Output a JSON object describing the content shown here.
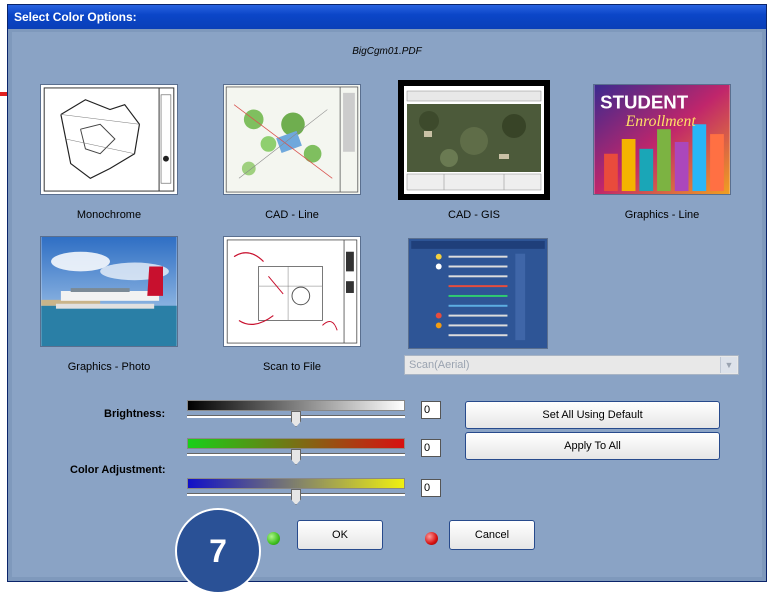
{
  "window": {
    "title": "Select Color Options:",
    "filename": "BigCgm01.PDF"
  },
  "thumbnails": [
    {
      "label": "Monochrome",
      "selected": false
    },
    {
      "label": "CAD - Line",
      "selected": false
    },
    {
      "label": "CAD - GIS",
      "selected": true
    },
    {
      "label": "Graphics - Line",
      "selected": false
    },
    {
      "label": "Graphics - Photo",
      "selected": false
    },
    {
      "label": "Scan to File",
      "selected": false
    },
    {
      "label": "",
      "selected": false
    }
  ],
  "poster_text": {
    "line1": "STUDENT",
    "line2": "Enrollment"
  },
  "combo": {
    "value": "Scan(Aerial)"
  },
  "controls": {
    "brightness_label": "Brightness:",
    "color_adjustment_label": "Color Adjustment:",
    "brightness_value": "0",
    "color_value_1": "0",
    "color_value_2": "0",
    "brightness_level": 0.5,
    "color_level_1": 0.5,
    "color_level_2": 0.5
  },
  "buttons": {
    "set_all_default": "Set All Using Default",
    "apply_to_all": "Apply To All",
    "ok": "OK",
    "cancel": "Cancel"
  },
  "step_badge": "7",
  "colors": {
    "ok_dot": "#3fbf1f",
    "cancel_dot": "#d61010",
    "badge": "#2a5196",
    "marker": "#e02020"
  }
}
